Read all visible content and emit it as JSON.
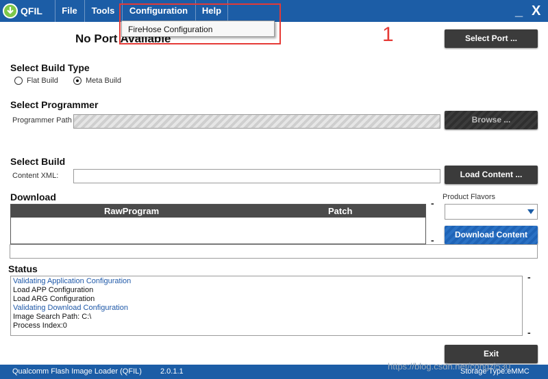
{
  "app": {
    "title": "QFIL"
  },
  "menu": [
    "File",
    "Tools",
    "Configuration",
    "Help"
  ],
  "window_controls": {
    "minimize": "_",
    "close": "X"
  },
  "dropdown_item": "FireHose Configuration",
  "annotation_number": "1",
  "port": {
    "status": "No Port Available",
    "select_button": "Select Port ..."
  },
  "build_type": {
    "heading": "Select Build Type",
    "options": [
      {
        "label": "Flat Build",
        "checked": false
      },
      {
        "label": "Meta Build",
        "checked": true
      }
    ]
  },
  "programmer": {
    "heading": "Select Programmer",
    "path_label": "Programmer Path",
    "path_value": "",
    "browse_button": "Browse ..."
  },
  "select_build": {
    "heading": "Select Build",
    "xml_label": "Content XML:",
    "xml_value": "",
    "load_button": "Load Content ..."
  },
  "download": {
    "heading": "Download",
    "columns": [
      "RawProgram",
      "Patch"
    ],
    "product_flavors_label": "Product Flavors",
    "product_flavor_value": "",
    "download_button": "Download Content",
    "dash": "-"
  },
  "status": {
    "heading": "Status",
    "lines": [
      {
        "text": "Validating Application Configuration",
        "color": "#1e58a8"
      },
      {
        "text": "Load APP Configuration",
        "color": "#111111"
      },
      {
        "text": "Load ARG Configuration",
        "color": "#111111"
      },
      {
        "text": "Validating Download Configuration",
        "color": "#1e58a8"
      },
      {
        "text": "Image Search Path: C:\\",
        "color": "#111111"
      },
      {
        "text": "Process Index:0",
        "color": "#111111"
      }
    ]
  },
  "exit_button": "Exit",
  "footer": {
    "app_full_name": "Qualcomm Flash Image Loader (QFIL)",
    "version": "2.0.1.1",
    "storage_type": "Storage Type:eMMC"
  },
  "watermark": {
    "url": "https://blog.csdn.net/congzi530"
  },
  "colors": {
    "accent": "#1c5da6",
    "annotation": "#e53935",
    "button_dark": "#3b3b3b",
    "button_blue": "#1e63b6"
  }
}
